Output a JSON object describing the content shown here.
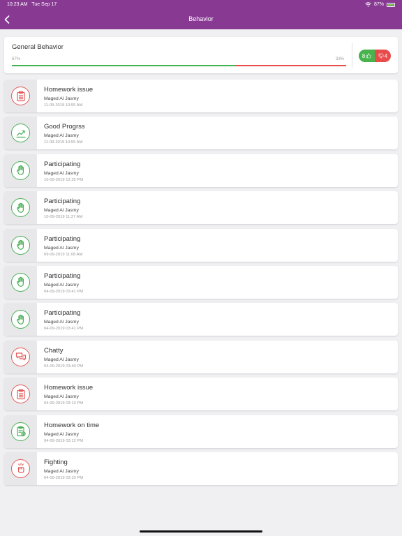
{
  "status_bar": {
    "time": "10:23 AM",
    "date": "Tue Sep 17",
    "battery": "87%"
  },
  "nav": {
    "title": "Behavior"
  },
  "summary": {
    "title": "General Behavior",
    "good_percent_label": "67%",
    "bad_percent_label": "33%",
    "good_fraction": 0.67,
    "good_count": "8",
    "bad_count": "4",
    "good_color": "#42b34a",
    "bad_color": "#e94b4b"
  },
  "records": [
    {
      "title": "Homework issue",
      "teacher": "Maged Al Jasmy",
      "date": "11-09-2019 10:55 AM",
      "type": "bad",
      "icon": "clipboard-icon"
    },
    {
      "title": "Good Progrss",
      "teacher": "Maged Al Jasmy",
      "date": "11-09-2019 10:55 AM",
      "type": "good",
      "icon": "trend-up-icon"
    },
    {
      "title": "Participating",
      "teacher": "Maged Al Jasmy",
      "date": "10-09-2019 12:25 PM",
      "type": "good",
      "icon": "raised-hand-icon"
    },
    {
      "title": "Participating",
      "teacher": "Maged Al Jasmy",
      "date": "10-09-2019 11:27 AM",
      "type": "good",
      "icon": "raised-hand-icon"
    },
    {
      "title": "Participating",
      "teacher": "Maged Al Jasmy",
      "date": "09-09-2019 11:08 AM",
      "type": "good",
      "icon": "raised-hand-icon"
    },
    {
      "title": "Participating",
      "teacher": "Maged Al Jasmy",
      "date": "04-09-2019 03:41 PM",
      "type": "good",
      "icon": "raised-hand-icon"
    },
    {
      "title": "Participating",
      "teacher": "Maged Al Jasmy",
      "date": "04-09-2019 03:41 PM",
      "type": "good",
      "icon": "raised-hand-icon"
    },
    {
      "title": "Chatty",
      "teacher": "Maged Al Jasmy",
      "date": "04-09-2019 03:40 PM",
      "type": "bad",
      "icon": "chat-bubbles-icon"
    },
    {
      "title": "Homework issue",
      "teacher": "Maged Al Jasmy",
      "date": "04-09-2019 03:13 PM",
      "type": "bad",
      "icon": "clipboard-icon"
    },
    {
      "title": "Homework on time",
      "teacher": "Maged Al Jasmy",
      "date": "04-09-2019 03:12 PM",
      "type": "good",
      "icon": "clipboard-check-icon"
    },
    {
      "title": "Fighting",
      "teacher": "Maged Al Jasmy",
      "date": "04-09-2019 03:10 PM",
      "type": "bad",
      "icon": "fist-icon"
    }
  ]
}
